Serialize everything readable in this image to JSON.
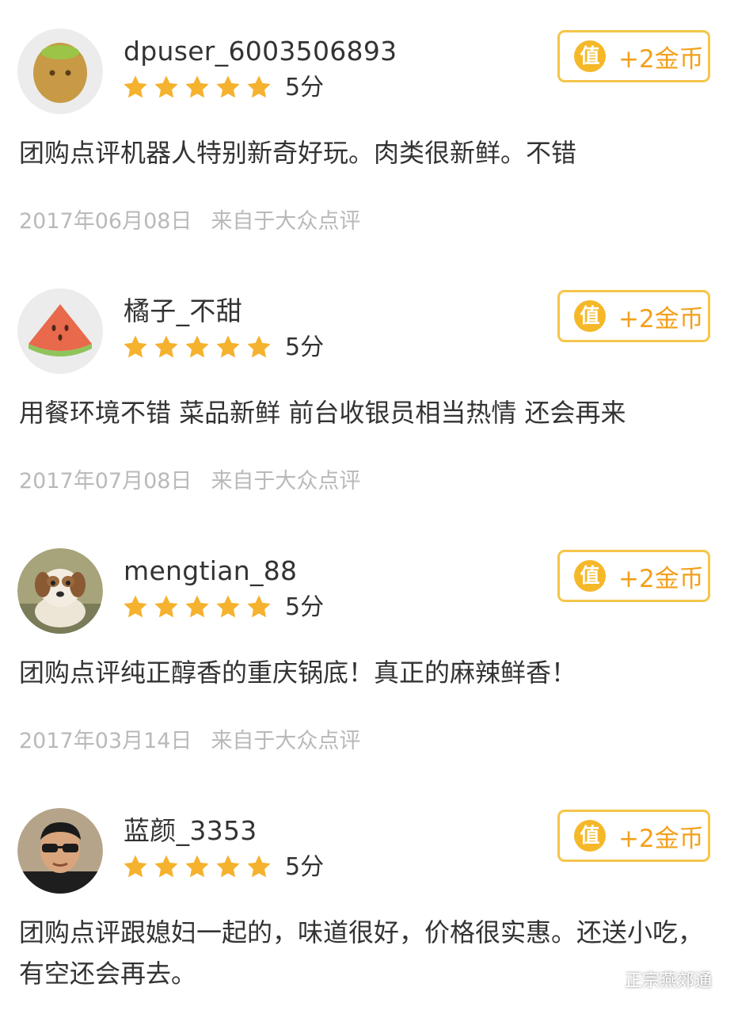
{
  "reviews": [
    {
      "username": "dpuser_6003506893",
      "avatar": "kiwi-avatar",
      "score": "5分",
      "coin_label": "+2金币",
      "coin_icon": "值",
      "content": "团购点评机器人特别新奇好玩。肉类很新鲜。不错",
      "date": "2017年06月08日",
      "source": "来自于大众点评"
    },
    {
      "username": "橘子_不甜",
      "avatar": "watermelon-avatar",
      "score": "5分",
      "coin_label": "+2金币",
      "coin_icon": "值",
      "content": "用餐环境不错 菜品新鲜 前台收银员相当热情 还会再来",
      "date": "2017年07月08日",
      "source": "来自于大众点评"
    },
    {
      "username": "mengtian_88",
      "avatar": "puppy-photo-avatar",
      "score": "5分",
      "coin_label": "+2金币",
      "coin_icon": "值",
      "content": "团购点评纯正醇香的重庆锅底！真正的麻辣鲜香！",
      "date": "2017年03月14日",
      "source": "来自于大众点评"
    },
    {
      "username": "蓝颜_3353",
      "avatar": "man-sunglasses-photo-avatar",
      "score": "5分",
      "coin_label": "+2金币",
      "coin_icon": "值",
      "content": "团购点评跟媳妇一起的，味道很好，价格很实惠。还送小吃，有空还会再去。",
      "date": "",
      "source": ""
    }
  ],
  "rating_stars": 5,
  "star_color": "#f5b22e",
  "accent_color": "#f2a01b",
  "watermark": {
    "icon": "wechat-icon",
    "text": "正宗燕郊通"
  }
}
